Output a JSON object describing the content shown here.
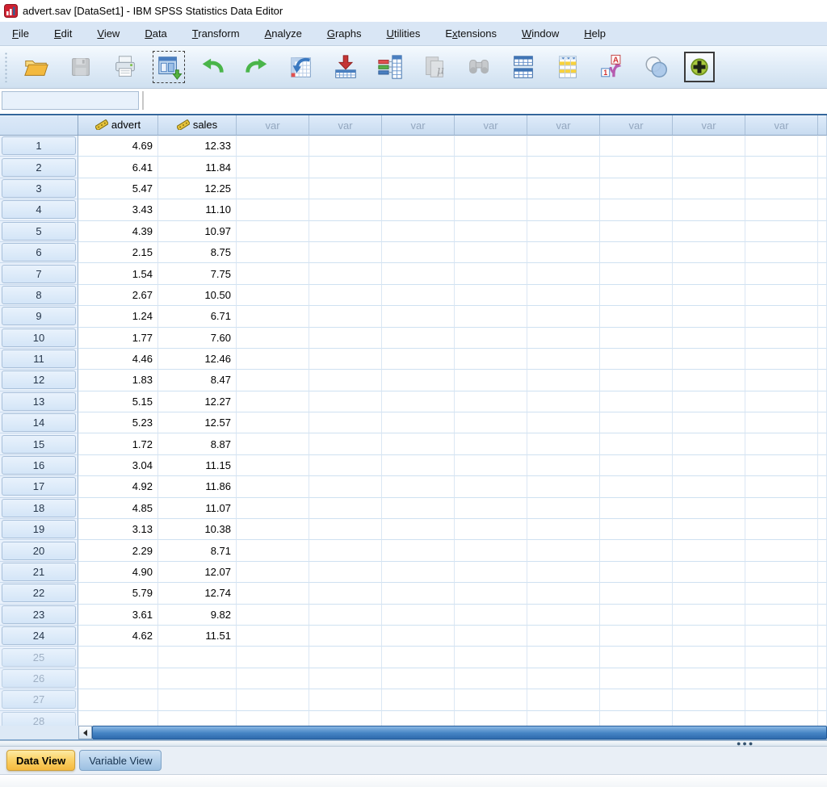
{
  "window": {
    "title": "advert.sav [DataSet1] - IBM SPSS Statistics Data Editor"
  },
  "menu_bar": {
    "items": [
      {
        "label": "File",
        "underline": 0
      },
      {
        "label": "Edit",
        "underline": 0
      },
      {
        "label": "View",
        "underline": 0
      },
      {
        "label": "Data",
        "underline": 0
      },
      {
        "label": "Transform",
        "underline": 0
      },
      {
        "label": "Analyze",
        "underline": 0
      },
      {
        "label": "Graphs",
        "underline": 0
      },
      {
        "label": "Utilities",
        "underline": 0
      },
      {
        "label": "Extensions",
        "underline": 1
      },
      {
        "label": "Window",
        "underline": 0
      },
      {
        "label": "Help",
        "underline": 0
      }
    ]
  },
  "toolbar": {
    "buttons": [
      {
        "id": "open-data",
        "icon": "folder-open-icon",
        "disabled": false
      },
      {
        "id": "save",
        "icon": "floppy-disk-icon",
        "disabled": true
      },
      {
        "id": "print",
        "icon": "printer-icon",
        "disabled": false
      },
      {
        "id": "recall-dialogs",
        "icon": "dialog-recall-icon",
        "disabled": false,
        "focused": true
      },
      {
        "id": "undo",
        "icon": "undo-arrow-icon",
        "disabled": false
      },
      {
        "id": "redo",
        "icon": "redo-arrow-icon",
        "disabled": false
      },
      {
        "id": "goto-case",
        "icon": "goto-case-table-icon",
        "disabled": false
      },
      {
        "id": "goto-variable",
        "icon": "goto-variable-table-icon",
        "disabled": false
      },
      {
        "id": "variables",
        "icon": "variable-list-icon",
        "disabled": false
      },
      {
        "id": "descriptives",
        "icon": "mu-sheets-icon",
        "disabled": true
      },
      {
        "id": "find",
        "icon": "binoculars-icon",
        "disabled": true
      },
      {
        "id": "split-file",
        "icon": "split-file-tables-icon",
        "disabled": false
      },
      {
        "id": "select-cases",
        "icon": "select-cases-table-icon",
        "disabled": false
      },
      {
        "id": "value-labels",
        "icon": "value-labels-icon",
        "disabled": false
      },
      {
        "id": "use-variable-sets",
        "icon": "venn-circles-icon",
        "disabled": false
      },
      {
        "id": "extension-plus",
        "icon": "green-plus-icon",
        "disabled": false,
        "framed": true
      }
    ]
  },
  "cell_editor": {
    "reference_value": "",
    "editor_value": ""
  },
  "data_grid": {
    "var_placeholder": "var",
    "var_column_count": 8,
    "columns": [
      {
        "name": "advert",
        "measure": "scale"
      },
      {
        "name": "sales",
        "measure": "scale"
      }
    ],
    "rows": [
      {
        "case": 1,
        "advert": "4.69",
        "sales": "12.33"
      },
      {
        "case": 2,
        "advert": "6.41",
        "sales": "11.84"
      },
      {
        "case": 3,
        "advert": "5.47",
        "sales": "12.25"
      },
      {
        "case": 4,
        "advert": "3.43",
        "sales": "11.10"
      },
      {
        "case": 5,
        "advert": "4.39",
        "sales": "10.97"
      },
      {
        "case": 6,
        "advert": "2.15",
        "sales": "8.75"
      },
      {
        "case": 7,
        "advert": "1.54",
        "sales": "7.75"
      },
      {
        "case": 8,
        "advert": "2.67",
        "sales": "10.50"
      },
      {
        "case": 9,
        "advert": "1.24",
        "sales": "6.71"
      },
      {
        "case": 10,
        "advert": "1.77",
        "sales": "7.60"
      },
      {
        "case": 11,
        "advert": "4.46",
        "sales": "12.46"
      },
      {
        "case": 12,
        "advert": "1.83",
        "sales": "8.47"
      },
      {
        "case": 13,
        "advert": "5.15",
        "sales": "12.27"
      },
      {
        "case": 14,
        "advert": "5.23",
        "sales": "12.57"
      },
      {
        "case": 15,
        "advert": "1.72",
        "sales": "8.87"
      },
      {
        "case": 16,
        "advert": "3.04",
        "sales": "11.15"
      },
      {
        "case": 17,
        "advert": "4.92",
        "sales": "11.86"
      },
      {
        "case": 18,
        "advert": "4.85",
        "sales": "11.07"
      },
      {
        "case": 19,
        "advert": "3.13",
        "sales": "10.38"
      },
      {
        "case": 20,
        "advert": "2.29",
        "sales": "8.71"
      },
      {
        "case": 21,
        "advert": "4.90",
        "sales": "12.07"
      },
      {
        "case": 22,
        "advert": "5.79",
        "sales": "12.74"
      },
      {
        "case": 23,
        "advert": "3.61",
        "sales": "9.82"
      },
      {
        "case": 24,
        "advert": "4.62",
        "sales": "11.51"
      }
    ],
    "empty_rows": [
      25,
      26,
      27,
      28
    ]
  },
  "tabs": {
    "data_view": "Data View",
    "variable_view": "Variable View",
    "active": "Data View"
  },
  "splitter_grip": "●●●",
  "colors": {
    "menu_bar_bg": "#d9e6f5",
    "grid_header_bg": "#d2e2f4",
    "gridline": "#cfe1f1",
    "scrollbar_thumb": "#3e7dbd",
    "active_tab": "#f9c652",
    "inactive_tab": "#a6c6e4"
  }
}
